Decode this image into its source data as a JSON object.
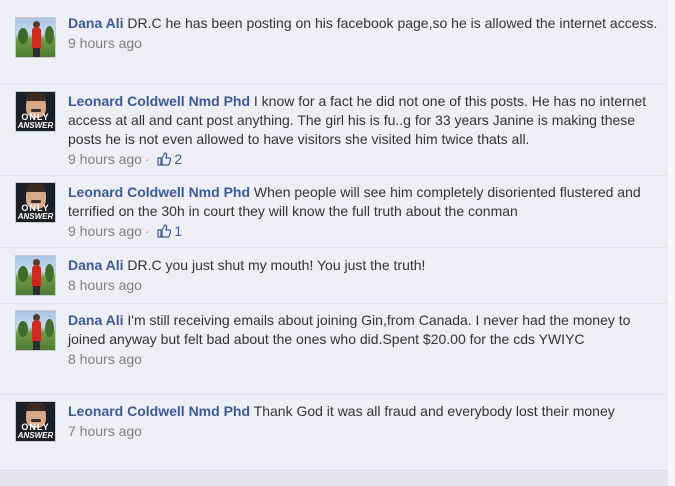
{
  "comments": [
    {
      "author": "Dana Ali",
      "text": "DR.C he has been posting on his facebook page,so he is allowed the internet access.",
      "time": "9 hours ago",
      "likes": ""
    },
    {
      "author": "Leonard Coldwell Nmd Phd",
      "text": "I know for a fact he did not one of this posts. He has no internet access at all and cant post anything. The girl his is fu..g for 33 years Janine is making these posts he is not even allowed to have visitors she visited him twice thats all.",
      "time": "9 hours ago",
      "likes": "2"
    },
    {
      "author": "Leonard Coldwell Nmd Phd",
      "text": "When people will see him completely disoriented flustered and terrified on the 30h in court they will know the full truth about the conman",
      "time": "9 hours ago",
      "likes": "1"
    },
    {
      "author": "Dana Ali",
      "text": "DR.C you just shut my mouth! You just the truth!",
      "time": "8 hours ago",
      "likes": ""
    },
    {
      "author": "Dana Ali",
      "text": "I'm still receiving emails about joining Gin,from Canada. I never had the money to joined anyway but felt bad about the ones who did.Spent $20.00 for the cds YWIYC",
      "time": "8 hours ago",
      "likes": ""
    },
    {
      "author": "Leonard Coldwell Nmd Phd",
      "text": "Thank God it was all fraud and everybody lost their money",
      "time": "7 hours ago",
      "likes": ""
    }
  ],
  "avatar_text": {
    "line1": "ONLY",
    "line2": "ANSWER"
  },
  "meta_separator": "·",
  "icons": {
    "like": "thumbs-up-icon"
  },
  "colors": {
    "author": "#3b5998",
    "meta": "#808080",
    "background": "#edeff4"
  }
}
